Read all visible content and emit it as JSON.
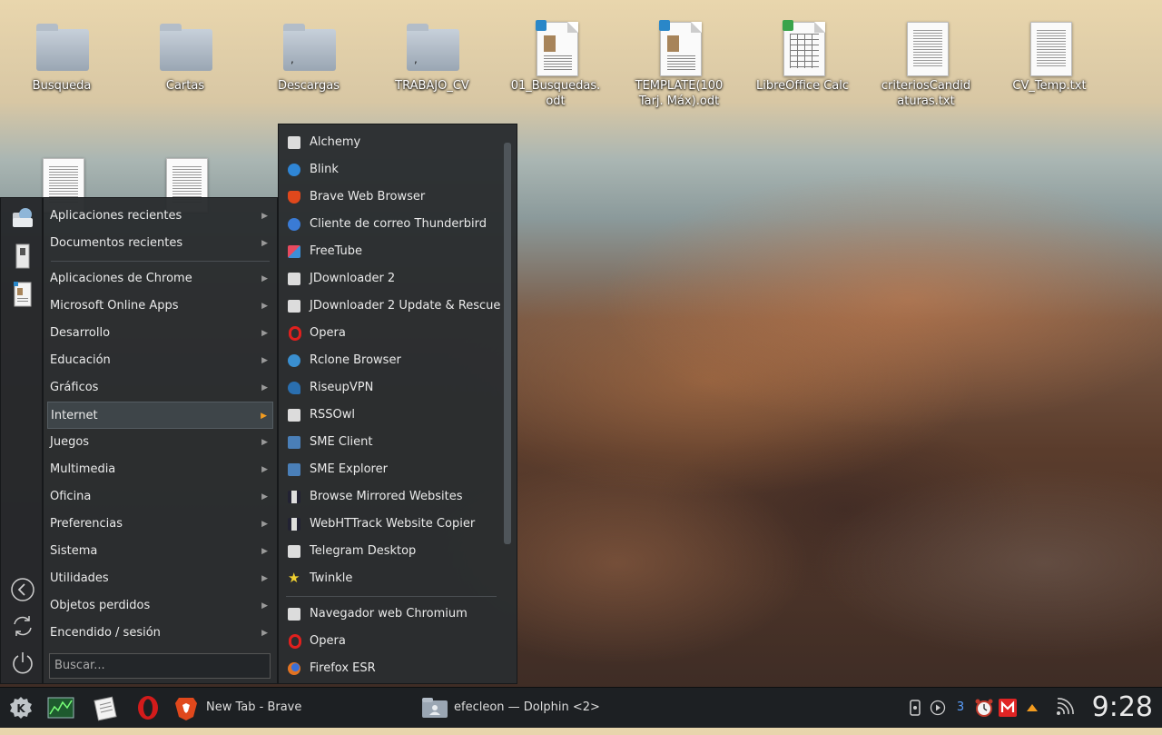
{
  "desktop": {
    "icons": [
      {
        "label": "Busqueda",
        "type": "folder"
      },
      {
        "label": "Cartas",
        "type": "folder"
      },
      {
        "label": "Descargas",
        "type": "folder"
      },
      {
        "label": "TRABAJO_CV",
        "type": "folder"
      },
      {
        "label": "01_Busquedas.\nodt",
        "type": "writer"
      },
      {
        "label": "TEMPLATE(100\nTarj. Máx).odt",
        "type": "writer"
      },
      {
        "label": "LibreOffice Calc",
        "type": "calc"
      },
      {
        "label": "criteriosCandid\naturas.txt",
        "type": "text"
      },
      {
        "label": "CV_Temp.txt",
        "type": "text"
      }
    ]
  },
  "launcher": {
    "categories": [
      {
        "label": "Aplicaciones recientes",
        "arrow": "▶"
      },
      {
        "label": "Documentos recientes",
        "arrow": "▶"
      },
      {
        "label": "Aplicaciones de Chrome",
        "arrow": "▶"
      },
      {
        "label": "Microsoft Online Apps",
        "arrow": "▶"
      },
      {
        "label": "Desarrollo",
        "arrow": "▶"
      },
      {
        "label": "Educación",
        "arrow": "▶"
      },
      {
        "label": "Gráficos",
        "arrow": "▶"
      },
      {
        "label": "Internet",
        "arrow": "▶"
      },
      {
        "label": "Juegos",
        "arrow": "▶"
      },
      {
        "label": "Multimedia",
        "arrow": "▶"
      },
      {
        "label": "Oficina",
        "arrow": "▶"
      },
      {
        "label": "Preferencias",
        "arrow": "▶"
      },
      {
        "label": "Sistema",
        "arrow": "▶"
      },
      {
        "label": "Utilidades",
        "arrow": "▶"
      },
      {
        "label": "Objetos perdidos",
        "arrow": "▶"
      },
      {
        "label": "Encendido / sesión",
        "arrow": "▶"
      }
    ],
    "active_category": "Internet",
    "search_placeholder": "Buscar...",
    "internet_apps": [
      {
        "label": "Alchemy",
        "icon": "generic-app-icon",
        "color": "#d8d8d8"
      },
      {
        "label": "Blink",
        "icon": "blink-icon",
        "color": "#2f86d6"
      },
      {
        "label": "Brave Web Browser",
        "icon": "brave-icon",
        "color": "#e0481c"
      },
      {
        "label": "Cliente de correo Thunderbird",
        "icon": "thunderbird-icon",
        "color": "#3a7bd5"
      },
      {
        "label": "FreeTube",
        "icon": "freetube-icon",
        "color": "#e84a5f"
      },
      {
        "label": "JDownloader 2",
        "icon": "generic-app-icon",
        "color": "#d8d8d8"
      },
      {
        "label": "JDownloader 2 Update & Rescue",
        "icon": "generic-app-icon",
        "color": "#d8d8d8"
      },
      {
        "label": "Opera",
        "icon": "opera-icon",
        "color": "#e0201e"
      },
      {
        "label": "Rclone Browser",
        "icon": "rclone-icon",
        "color": "#3a8fd0"
      },
      {
        "label": "RiseupVPN",
        "icon": "riseup-icon",
        "color": "#2a6fb0"
      },
      {
        "label": "RSSOwl",
        "icon": "generic-app-icon",
        "color": "#d8d8d8"
      },
      {
        "label": "SME Client",
        "icon": "sme-client-icon",
        "color": "#4a7fb8"
      },
      {
        "label": "SME Explorer",
        "icon": "sme-explorer-icon",
        "color": "#4a7fb8"
      },
      {
        "label": "Browse Mirrored Websites",
        "icon": "httrack-icon",
        "color": "#334"
      },
      {
        "label": "WebHTTrack Website Copier",
        "icon": "httrack-icon",
        "color": "#334"
      },
      {
        "label": "Telegram Desktop",
        "icon": "generic-app-icon",
        "color": "#d8d8d8"
      },
      {
        "label": "Twinkle",
        "icon": "star-icon",
        "color": "#f0d030"
      },
      {
        "label": "Navegador web Chromium",
        "icon": "generic-app-icon",
        "color": "#d8d8d8"
      },
      {
        "label": "Opera",
        "icon": "opera-icon",
        "color": "#e0201e"
      },
      {
        "label": "Firefox ESR",
        "icon": "firefox-icon",
        "color": "#e27322"
      }
    ]
  },
  "taskbar": {
    "tasks": [
      {
        "label": "New Tab - Brave"
      },
      {
        "label": "efecleon — Dolphin <2>"
      }
    ],
    "tray": {
      "badge_count": "3"
    },
    "clock": "9:28"
  }
}
